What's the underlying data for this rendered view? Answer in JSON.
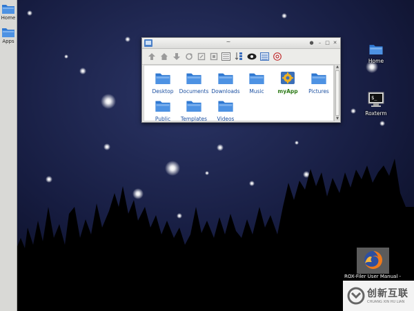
{
  "panel": {
    "items": [
      {
        "label": "Home"
      },
      {
        "label": "Apps"
      }
    ]
  },
  "desktop": {
    "icons": [
      {
        "label": "Home"
      },
      {
        "label": "Roxterm"
      }
    ],
    "selected_item": {
      "label": "ROX-Filer User Manual - "
    }
  },
  "file_manager": {
    "title": "~",
    "files": [
      {
        "label": "Desktop"
      },
      {
        "label": "Documents"
      },
      {
        "label": "Downloads"
      },
      {
        "label": "Music"
      },
      {
        "label": "myApp"
      },
      {
        "label": "Pictures"
      },
      {
        "label": "Public"
      },
      {
        "label": "Templates"
      },
      {
        "label": "Videos"
      }
    ]
  },
  "watermark": {
    "title": "创新互联",
    "subtitle": "CHUANG XIN HU LIAN"
  },
  "colors": {
    "folder": "#2f77d0",
    "folder_light": "#7fb2ee",
    "file_label": "#1b4fa0",
    "app_label": "#2c7a16"
  }
}
